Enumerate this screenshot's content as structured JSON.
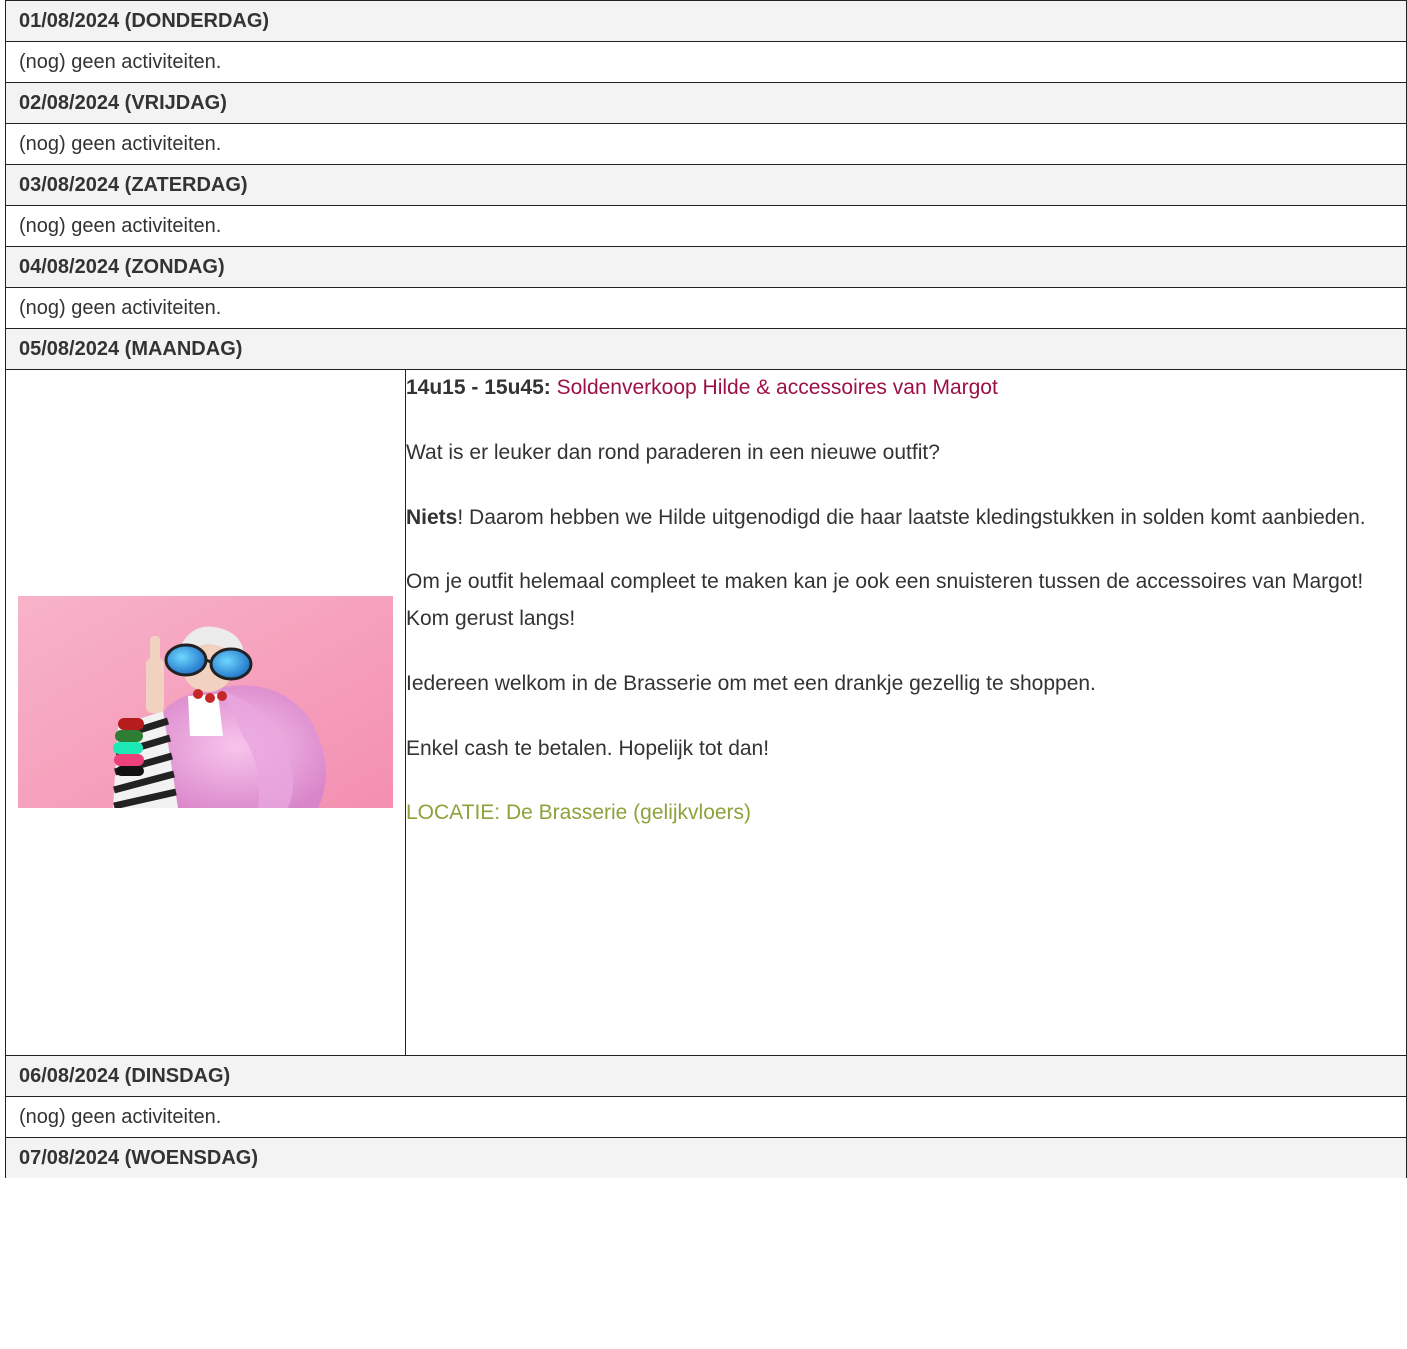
{
  "days": [
    {
      "header": "01/08/2024 (DONDERDAG)",
      "empty_text": "(nog) geen activiteiten."
    },
    {
      "header": "02/08/2024 (VRIJDAG)",
      "empty_text": "(nog) geen activiteiten."
    },
    {
      "header": "03/08/2024 (ZATERDAG)",
      "empty_text": "(nog) geen activiteiten."
    },
    {
      "header": "04/08/2024 (ZONDAG)",
      "empty_text": "(nog) geen activiteiten."
    }
  ],
  "event_day": {
    "header": "05/08/2024 (MAANDAG)",
    "event": {
      "time": "14u15 - 15u45:",
      "title": "Soldenverkoop Hilde & accessoires van Margot",
      "paragraph_1": "Wat is er leuker dan rond paraderen in een nieuwe outfit?",
      "paragraph_2_bold": "Niets",
      "paragraph_2_rest": "! Daarom hebben we Hilde uitgenodigd die haar laatste kledingstukken in solden komt aanbieden.",
      "paragraph_3": "Om je outfit helemaal compleet te maken kan je ook een snuisteren tussen de accessoires van Margot! Kom gerust langs!",
      "paragraph_4": "Iedereen welkom in de Brasserie om met een drankje gezellig te shoppen.",
      "paragraph_5": "Enkel cash te betalen. Hopelijk tot dan!",
      "location": "LOCATIE: De Brasserie (gelijkvloers)"
    }
  },
  "days_after": [
    {
      "header": "06/08/2024 (DINSDAG)",
      "empty_text": "(nog) geen activiteiten."
    }
  ],
  "last_day": {
    "header": "07/08/2024 (WOENSDAG)"
  },
  "colors": {
    "title_link": "#9c1046",
    "location": "#8ba33b",
    "header_bg": "#f3f3f3"
  }
}
